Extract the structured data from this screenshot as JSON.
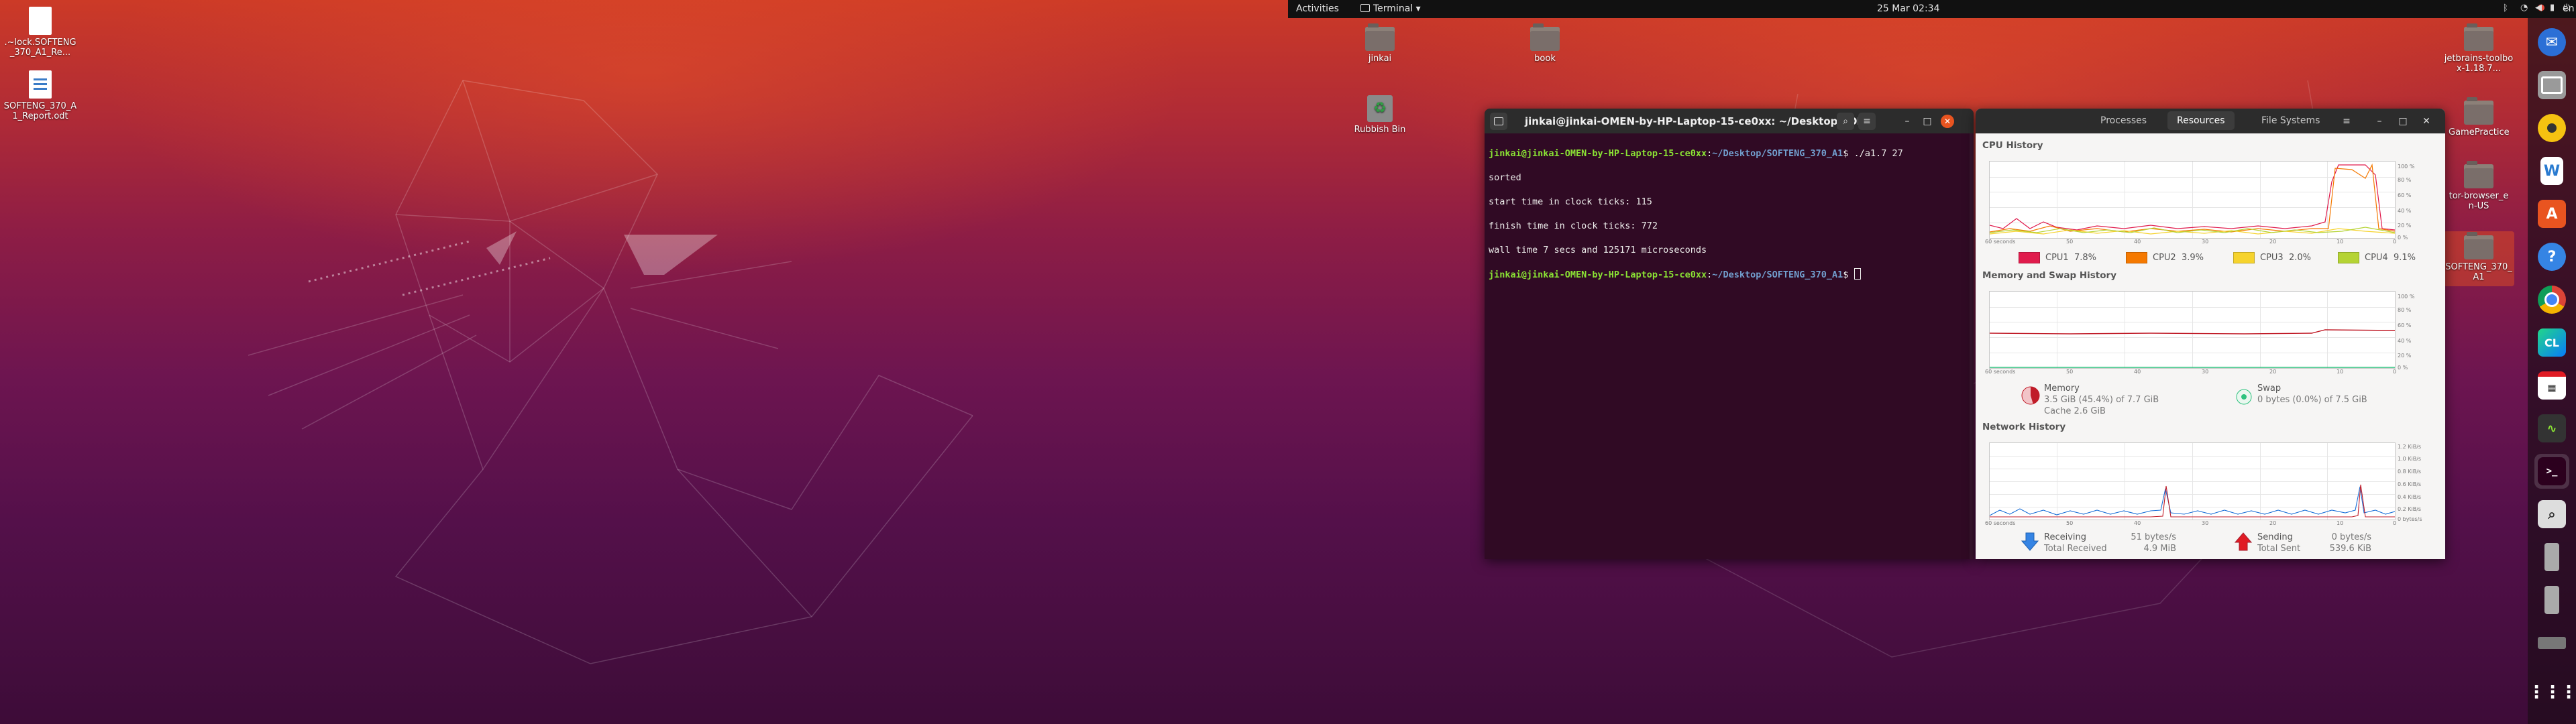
{
  "topbar": {
    "activities": "Activities",
    "app_menu": "Terminal",
    "app_menu_arrow": "▾",
    "clock": "25 Mar  02:34",
    "language": "en",
    "language_arrow": "▾",
    "tray_icons": [
      "chrome-tray-icon",
      "bluetooth-icon",
      "network-icon",
      "volume-icon",
      "battery-icon",
      "power-menu-icon"
    ]
  },
  "desktop_left": {
    "files": [
      {
        "name": ".~lock.SOFTENG_370_A1_Re...",
        "icon": "document-icon"
      },
      {
        "name": "SOFTENG_370_A1_Report.odt",
        "icon": "writer-document-icon"
      }
    ]
  },
  "desktop_right": {
    "items": [
      {
        "name": "jinkai",
        "icon": "home-folder-icon"
      },
      {
        "name": "book",
        "icon": "folder-icon"
      },
      {
        "name": "Rubbish Bin",
        "icon": "trash-icon"
      },
      {
        "name": "jetbrains-toolbox-1.18.7...",
        "icon": "folder-icon"
      },
      {
        "name": "GamePractice",
        "icon": "folder-icon"
      },
      {
        "name": "tor-browser_en-US",
        "icon": "folder-icon"
      },
      {
        "name": "SOFTENG_370_A1",
        "icon": "folder-icon"
      }
    ]
  },
  "terminal": {
    "title": "jinkai@jinkai-OMEN-by-HP-Laptop-15-ce0xx: ~/Desktop/SOF...",
    "prompt_user": "jinkai@jinkai-OMEN-by-HP-Laptop-15-ce0xx",
    "prompt_path": "~/Desktop/SOFTENG_370_A1",
    "command": "./a1.7 27",
    "output": [
      "sorted",
      "start time in clock ticks: 115",
      "finish time in clock ticks: 772",
      "wall time 7 secs and 125171 microseconds"
    ]
  },
  "sysmon": {
    "tabs": [
      "Processes",
      "Resources",
      "File Systems"
    ],
    "active_tab": "Resources",
    "cpu": {
      "title": "CPU History",
      "cpus": [
        {
          "label": "CPU1",
          "value": "7.8%",
          "color": "#e01b4c"
        },
        {
          "label": "CPU2",
          "value": "3.9%",
          "color": "#f57900"
        },
        {
          "label": "CPU3",
          "value": "2.0%",
          "color": "#f6d32d"
        },
        {
          "label": "CPU4",
          "value": "9.1%",
          "color": "#b5d334"
        }
      ]
    },
    "memory": {
      "title": "Memory and Swap History",
      "mem_label": "Memory",
      "mem_value": "3.5 GiB (45.4%) of 7.7 GiB",
      "cache_value": "Cache 2.6 GiB",
      "swap_label": "Swap",
      "swap_value": "0 bytes (0.0%) of 7.5 GiB",
      "mem_percent": 45.4,
      "swap_percent": 0.0
    },
    "network": {
      "title": "Network History",
      "receiving_label": "Receiving",
      "receiving_value": "51 bytes/s",
      "total_received_label": "Total Received",
      "total_received_value": "4.9 MiB",
      "sending_label": "Sending",
      "sending_value": "0 bytes/s",
      "total_sent_label": "Total Sent",
      "total_sent_value": "539.6 KiB"
    },
    "y_ticks_pct": [
      "100 %",
      "80 %",
      "60 %",
      "40 %",
      "20 %",
      "0 %"
    ],
    "y_ticks_net": [
      "1.2 KiB/s",
      "1.0 KiB/s",
      "0.8 KiB/s",
      "0.6 KiB/s",
      "0.4 KiB/s",
      "0.2 KiB/s",
      "0 bytes/s"
    ],
    "x_ticks": [
      "60 seconds",
      "50",
      "40",
      "30",
      "20",
      "10",
      "0"
    ]
  },
  "dock": {
    "apps": [
      "thunderbird-icon",
      "files-icon",
      "rhythmbox-icon",
      "writer-icon",
      "software-center-icon",
      "help-icon",
      "chrome-icon",
      "clion-icon",
      "calendar-app-icon",
      "system-monitor-icon",
      "terminal-icon",
      "image-viewer-icon",
      "usb-drive-icon",
      "usb-drive-icon-2",
      "removable-drive-icon",
      "show-apps-icon"
    ]
  }
}
